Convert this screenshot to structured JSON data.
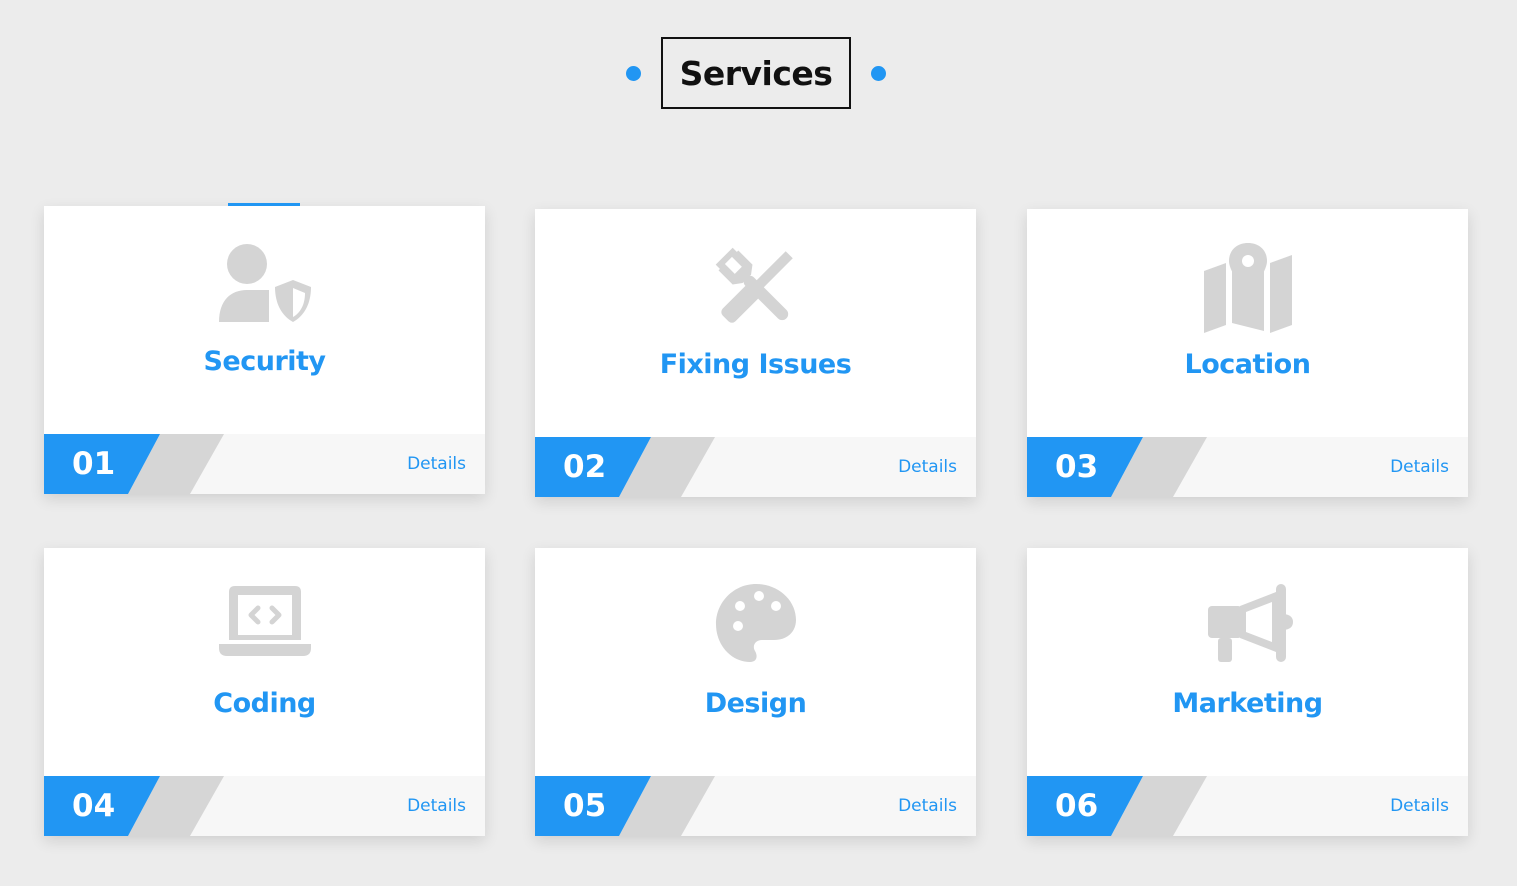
{
  "section": {
    "title": "Services"
  },
  "colors": {
    "accent": "#2196f3",
    "icon": "#d4d4d4",
    "stripe_gray": "#d6d6d6",
    "background": "#ececec"
  },
  "services": [
    {
      "number": "01",
      "title": "Security",
      "details_label": "Details",
      "icon": "user-shield-icon"
    },
    {
      "number": "02",
      "title": "Fixing Issues",
      "details_label": "Details",
      "icon": "tools-icon"
    },
    {
      "number": "03",
      "title": "Location",
      "details_label": "Details",
      "icon": "map-location-icon"
    },
    {
      "number": "04",
      "title": "Coding",
      "details_label": "Details",
      "icon": "laptop-code-icon"
    },
    {
      "number": "05",
      "title": "Design",
      "details_label": "Details",
      "icon": "palette-icon"
    },
    {
      "number": "06",
      "title": "Marketing",
      "details_label": "Details",
      "icon": "megaphone-icon"
    }
  ]
}
